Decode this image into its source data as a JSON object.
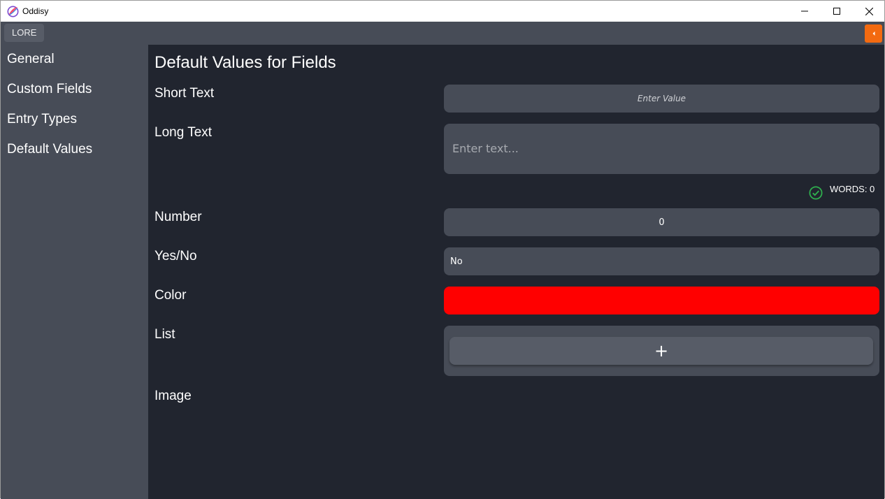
{
  "window": {
    "title": "Oddisy"
  },
  "toolbar": {
    "lore_label": "LORE"
  },
  "sidebar": {
    "items": [
      {
        "label": "General"
      },
      {
        "label": "Custom Fields"
      },
      {
        "label": "Entry Types"
      },
      {
        "label": "Default Values"
      }
    ]
  },
  "main": {
    "title": "Default Values for Fields",
    "fields": {
      "short_text": {
        "label": "Short Text",
        "placeholder": "Enter Value"
      },
      "long_text": {
        "label": "Long Text",
        "placeholder": "Enter text...",
        "word_count": "WORDS: 0"
      },
      "number": {
        "label": "Number",
        "value": "0"
      },
      "yes_no": {
        "label": "Yes/No",
        "value": "No"
      },
      "color": {
        "label": "Color",
        "value": "#ff0000"
      },
      "list": {
        "label": "List",
        "add_label": "+"
      },
      "image": {
        "label": "Image"
      }
    }
  },
  "colors": {
    "accent": "#f36a10",
    "background": "#21252f",
    "panel": "#474c57",
    "success": "#2fae4e"
  }
}
